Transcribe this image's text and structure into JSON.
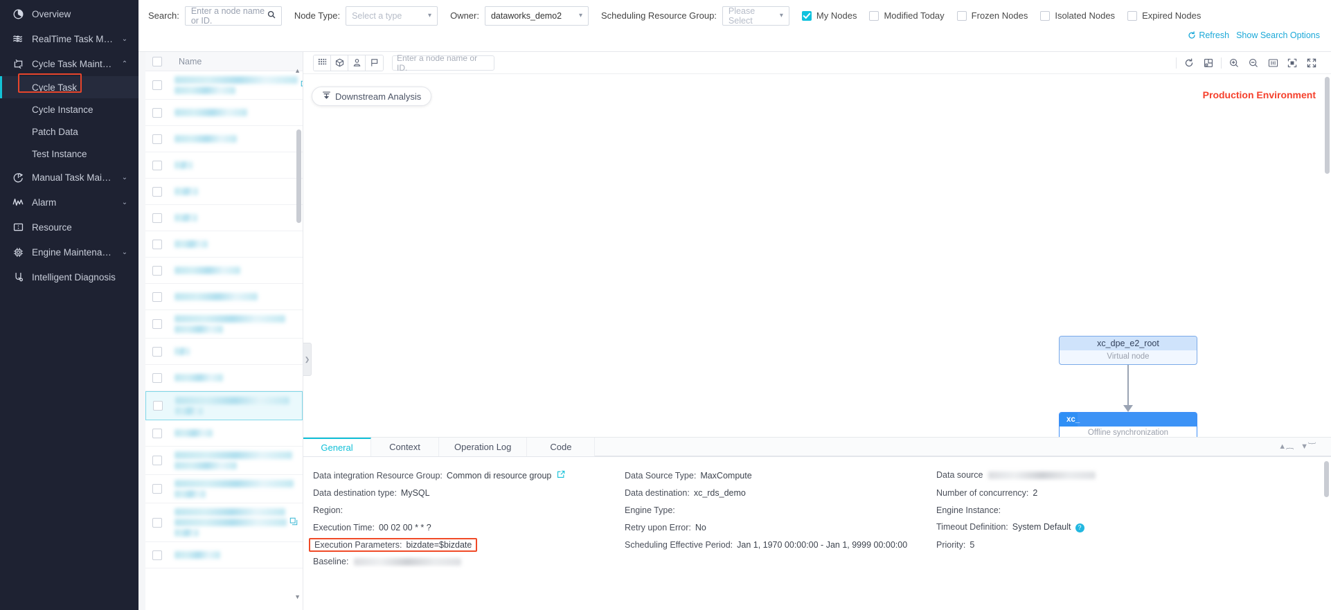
{
  "sidebar": {
    "items": [
      {
        "label": "Overview",
        "icon": "pie-chart-icon",
        "caret": "",
        "type": "item"
      },
      {
        "label": "RealTime Task Mainten...",
        "icon": "waves-icon",
        "caret": "⌄",
        "type": "item"
      },
      {
        "label": "Cycle Task Maintenance",
        "icon": "cycle-icon",
        "caret": "⌃",
        "type": "item"
      },
      {
        "label": "Cycle Task",
        "type": "sub",
        "active": true
      },
      {
        "label": "Cycle Instance",
        "type": "sub",
        "active": false
      },
      {
        "label": "Patch Data",
        "type": "sub",
        "active": false
      },
      {
        "label": "Test Instance",
        "type": "sub",
        "active": false
      },
      {
        "label": "Manual Task Maintenan...",
        "icon": "manual-icon",
        "caret": "⌄",
        "type": "item"
      },
      {
        "label": "Alarm",
        "icon": "alarm-icon",
        "caret": "⌄",
        "type": "item"
      },
      {
        "label": "Resource",
        "icon": "resource-icon",
        "caret": "",
        "type": "item"
      },
      {
        "label": "Engine Maintenance",
        "icon": "engine-icon",
        "caret": "⌄",
        "type": "item"
      },
      {
        "label": "Intelligent Diagnosis",
        "icon": "diagnosis-icon",
        "caret": "",
        "type": "item"
      }
    ],
    "highlight_color": "#e8452b",
    "active_bar_color": "#13c2d6"
  },
  "search_bar": {
    "search_label": "Search:",
    "search_placeholder": "Enter a node name or ID.",
    "node_type_label": "Node Type:",
    "node_type_value": "Select a type",
    "owner_label": "Owner:",
    "owner_value": "dataworks_demo2",
    "resource_group_label": "Scheduling Resource Group:",
    "resource_group_value": "Please Select",
    "checkboxes": [
      {
        "label": "My Nodes",
        "checked": true
      },
      {
        "label": "Modified Today",
        "checked": false
      },
      {
        "label": "Frozen Nodes",
        "checked": false
      },
      {
        "label": "Isolated Nodes",
        "checked": false
      },
      {
        "label": "Expired Nodes",
        "checked": false
      }
    ],
    "refresh_label": "Refresh",
    "search_options_label": "Show Search Options",
    "link_color": "#1aa8d8",
    "accent_color": "#0fc2de"
  },
  "node_list": {
    "column_header": "Name",
    "rows": [
      {
        "lines": [
          88,
          52
        ],
        "widths": [
          178,
          88
        ],
        "selected": false,
        "icon": "copy-icon"
      },
      {
        "lines": [
          1
        ],
        "widths": [
          105
        ],
        "selected": false,
        "icon": ""
      },
      {
        "lines": [
          1
        ],
        "widths": [
          90
        ],
        "selected": false,
        "icon": ""
      },
      {
        "lines": [
          1
        ],
        "widths": [
          26
        ],
        "selected": false,
        "icon": ""
      },
      {
        "lines": [
          1
        ],
        "widths": [
          34
        ],
        "selected": false,
        "icon": ""
      },
      {
        "lines": [
          1
        ],
        "widths": [
          33
        ],
        "selected": false,
        "icon": ""
      },
      {
        "lines": [
          1
        ],
        "widths": [
          48
        ],
        "selected": false,
        "icon": ""
      },
      {
        "lines": [
          1
        ],
        "widths": [
          95
        ],
        "selected": false,
        "icon": ""
      },
      {
        "lines": [
          1
        ],
        "widths": [
          120
        ],
        "selected": false,
        "icon": ""
      },
      {
        "lines": [
          2
        ],
        "widths": [
          160,
          70
        ],
        "selected": false,
        "icon": ""
      },
      {
        "lines": [
          1
        ],
        "widths": [
          22
        ],
        "selected": false,
        "icon": ""
      },
      {
        "lines": [
          1
        ],
        "widths": [
          70
        ],
        "selected": false,
        "icon": ""
      },
      {
        "lines": [
          2
        ],
        "widths": [
          165,
          40
        ],
        "selected": true,
        "icon": ""
      },
      {
        "lines": [
          1
        ],
        "widths": [
          55
        ],
        "selected": false,
        "icon": ""
      },
      {
        "lines": [
          2
        ],
        "widths": [
          170,
          90
        ],
        "selected": false,
        "icon": ""
      },
      {
        "lines": [
          2
        ],
        "widths": [
          172,
          45
        ],
        "selected": false,
        "icon": ""
      },
      {
        "lines": [
          3
        ],
        "widths": [
          160,
          162,
          35
        ],
        "selected": false,
        "icon": "copy-icon"
      },
      {
        "lines": [
          1
        ],
        "widths": [
          66
        ],
        "selected": false,
        "icon": ""
      }
    ]
  },
  "graph_toolbar": {
    "left_buttons": [
      {
        "icon": "grid-icon",
        "name": "grid-view-button"
      },
      {
        "icon": "cube-icon",
        "name": "cube-view-button"
      },
      {
        "icon": "person-icon",
        "name": "owner-view-button"
      },
      {
        "icon": "flag-icon",
        "name": "flag-view-button"
      }
    ],
    "search_placeholder": "Enter a node name or ID.",
    "right_buttons": [
      {
        "icon": "refresh-icon",
        "name": "refresh-graph-button"
      },
      {
        "icon": "layout-icon",
        "name": "layout-toggle-button"
      },
      {
        "icon": "zoom-in-icon",
        "name": "zoom-in-button"
      },
      {
        "icon": "zoom-out-icon",
        "name": "zoom-out-button"
      },
      {
        "icon": "actual-size-icon",
        "name": "actual-size-button"
      },
      {
        "icon": "fit-screen-icon",
        "name": "fit-screen-button"
      },
      {
        "icon": "fullscreen-icon",
        "name": "fullscreen-button"
      }
    ]
  },
  "canvas": {
    "downstream_button": "Downstream Analysis",
    "environment_label": "Production Environment",
    "environment_color": "#f5402c",
    "nodes": [
      {
        "title": "xc_dpe_e2_root",
        "subtitle": "Virtual node",
        "state": "normal"
      },
      {
        "title": "xc_",
        "subtitle": "Offline synchronization",
        "state": "selected"
      }
    ]
  },
  "detail_panel": {
    "tabs": [
      {
        "label": "General",
        "active": true
      },
      {
        "label": "Context",
        "active": false
      },
      {
        "label": "Operation Log",
        "active": false
      },
      {
        "label": "Code",
        "active": false
      }
    ],
    "column1": [
      {
        "key": "Data integration Resource Group:",
        "value": "Common di resource group",
        "icon": "external-link-icon"
      },
      {
        "key": "Data destination type:",
        "value": "MySQL"
      },
      {
        "key": "Region:",
        "value": ""
      },
      {
        "key": "Execution Time:",
        "value": "00 02 00 * * ?"
      },
      {
        "key": "Execution Parameters:",
        "value": "bizdate=$bizdate",
        "highlighted": true
      },
      {
        "key": "Baseline:",
        "value": "",
        "blurred": true
      }
    ],
    "column2": [
      {
        "key": "Data Source Type:",
        "value": "MaxCompute"
      },
      {
        "key": "Data destination:",
        "value": "xc_rds_demo"
      },
      {
        "key": "Engine Type:",
        "value": ""
      },
      {
        "key": "Retry upon Error:",
        "value": "No"
      },
      {
        "key": "Scheduling Effective Period:",
        "value": "Jan 1, 1970 00:00:00 - Jan 1, 9999 00:00:00"
      }
    ],
    "column3": [
      {
        "key": "Data source",
        "value": "",
        "blurred": true
      },
      {
        "key": "Number of concurrency:",
        "value": "2"
      },
      {
        "key": "Engine Instance:",
        "value": ""
      },
      {
        "key": "Timeout Definition:",
        "value": "System Default",
        "icon": "help-icon"
      },
      {
        "key": "Priority:",
        "value": "5"
      }
    ],
    "collapse_up_icon": "chevron-double-up-icon",
    "collapse_down_icon": "chevron-double-down-icon",
    "highlight_color": "#f04a27"
  }
}
